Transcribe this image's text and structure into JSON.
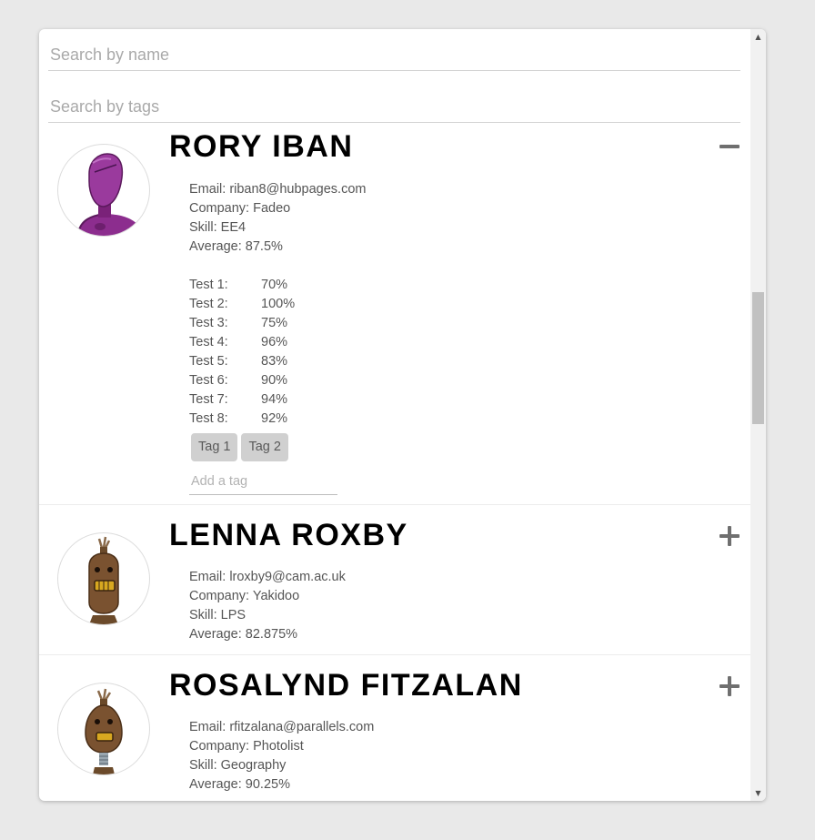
{
  "search": {
    "name_placeholder": "Search by name",
    "tags_placeholder": "Search by tags"
  },
  "students": [
    {
      "name": "RORY IBAN",
      "email": "Email: riban8@hubpages.com",
      "company": "Company: Fadeo",
      "skill": "Skill: EE4",
      "average": "Average: 87.5%",
      "expanded": true,
      "toggle_icon": "minus-icon",
      "avatar_icon": "purple-robot-icon",
      "grades": [
        {
          "label": "Test 1:",
          "value": "70%"
        },
        {
          "label": "Test 2:",
          "value": "100%"
        },
        {
          "label": "Test 3:",
          "value": "75%"
        },
        {
          "label": "Test 4:",
          "value": "96%"
        },
        {
          "label": "Test 5:",
          "value": "83%"
        },
        {
          "label": "Test 6:",
          "value": "90%"
        },
        {
          "label": "Test 7:",
          "value": "94%"
        },
        {
          "label": "Test 8:",
          "value": "92%"
        }
      ],
      "tags": [
        "Tag 1",
        "Tag 2"
      ],
      "add_tag_placeholder": "Add a tag"
    },
    {
      "name": "LENNA ROXBY",
      "email": "Email: lroxby9@cam.ac.uk",
      "company": "Company: Yakidoo",
      "skill": "Skill: LPS",
      "average": "Average: 82.875%",
      "expanded": false,
      "toggle_icon": "plus-icon",
      "avatar_icon": "brown-robot-icon"
    },
    {
      "name": "ROSALYND FITZALAN",
      "email": "Email: rfitzalana@parallels.com",
      "company": "Company: Photolist",
      "skill": "Skill: Geography",
      "average": "Average: 90.25%",
      "expanded": false,
      "toggle_icon": "plus-icon",
      "avatar_icon": "brown-robot-icon"
    }
  ],
  "colors": {
    "background": "#e9e9e9",
    "card": "#ffffff",
    "tag_bg": "#d0d0d0",
    "toggle": "#6f6f6f",
    "robot_purple": "#8c2d8e",
    "robot_brown": "#7a5230"
  }
}
